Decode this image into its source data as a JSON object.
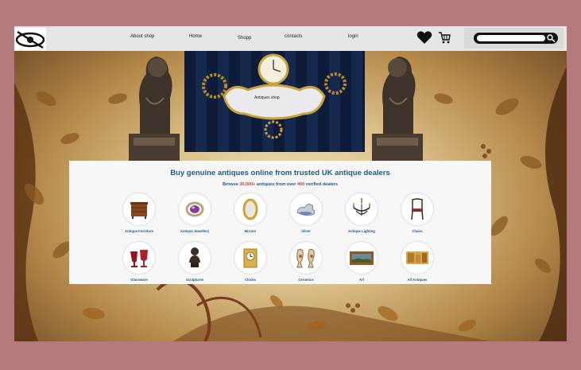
{
  "nav": {
    "links": [
      "About shop",
      "Home",
      "Shopp",
      "contacts",
      "login"
    ]
  },
  "hero": {
    "label": "Antiques shop"
  },
  "panel": {
    "title": "Buy genuine antiques online from trusted UK antique dealers",
    "subtitle_pre": "Browse ",
    "subtitle_count1": "30,000+",
    "subtitle_mid": " antiques from over ",
    "subtitle_count2": "400",
    "subtitle_post": " verified dealers"
  },
  "categories": [
    {
      "label": "Antique Furniture",
      "icon": "furniture-icon"
    },
    {
      "label": "Antique Jewellery",
      "icon": "jewellery-icon"
    },
    {
      "label": "Mirrors",
      "icon": "mirror-icon"
    },
    {
      "label": "Silver",
      "icon": "silver-icon"
    },
    {
      "label": "Antique Lighting",
      "icon": "chandelier-icon"
    },
    {
      "label": "Chairs",
      "icon": "chair-icon"
    },
    {
      "label": "Glassware",
      "icon": "glassware-icon"
    },
    {
      "label": "Sculptures",
      "icon": "sculpture-icon"
    },
    {
      "label": "Clocks",
      "icon": "clock-icon"
    },
    {
      "label": "Ceramics",
      "icon": "ceramics-icon"
    },
    {
      "label": "Art",
      "icon": "painting-icon"
    },
    {
      "label": "All Antiques",
      "icon": "all-antiques-icon"
    }
  ],
  "colors": {
    "background": "#b47a7e",
    "navbar": "#e6e6e6",
    "accent_text": "#1f5b7d",
    "highlight": "#d43a2a"
  }
}
